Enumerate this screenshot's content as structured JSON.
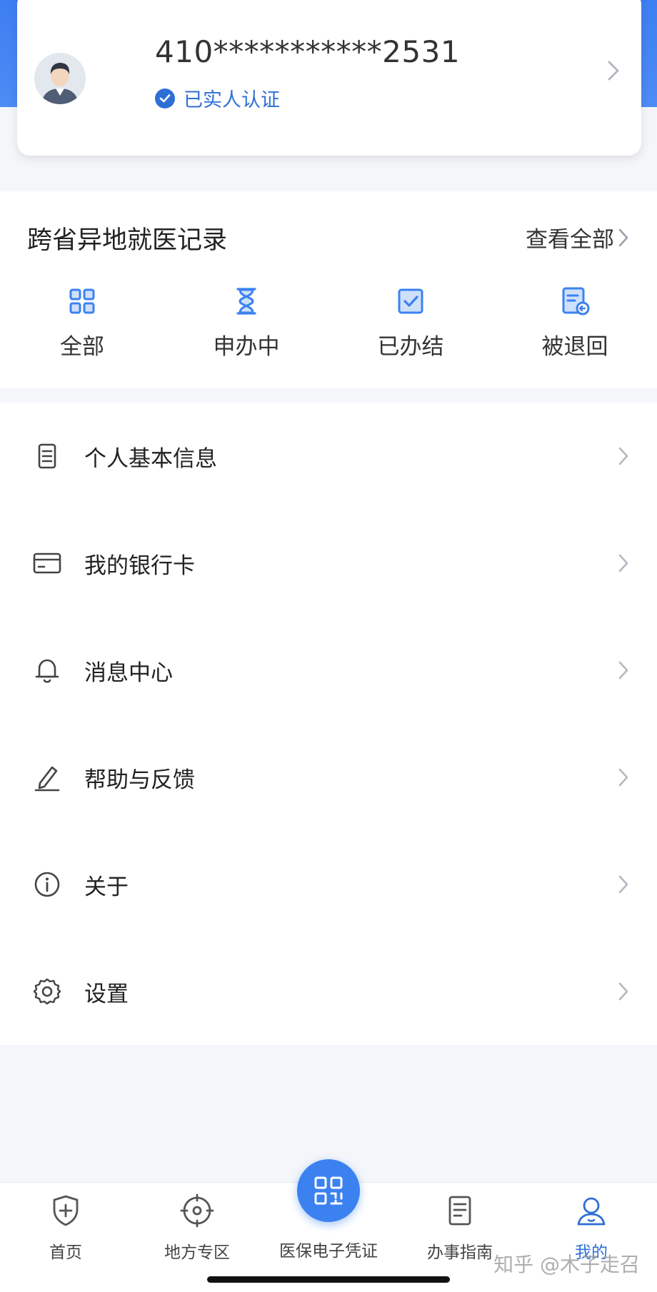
{
  "profile": {
    "id_masked": "410***********2531",
    "verified_label": "已实人认证"
  },
  "records": {
    "title": "跨省异地就医记录",
    "view_all": "查看全部",
    "tabs": [
      {
        "label": "全部",
        "icon": "grid-icon"
      },
      {
        "label": "申办中",
        "icon": "hourglass-icon"
      },
      {
        "label": "已办结",
        "icon": "checked-box-icon"
      },
      {
        "label": "被退回",
        "icon": "returned-document-icon"
      }
    ]
  },
  "menu": {
    "items": [
      {
        "label": "个人基本信息",
        "icon": "document-icon"
      },
      {
        "label": "我的银行卡",
        "icon": "card-icon"
      },
      {
        "label": "消息中心",
        "icon": "bell-icon"
      },
      {
        "label": "帮助与反馈",
        "icon": "pen-icon"
      },
      {
        "label": "关于",
        "icon": "info-icon"
      },
      {
        "label": "设置",
        "icon": "gear-icon"
      }
    ]
  },
  "nav": {
    "items": [
      {
        "label": "首页",
        "icon": "shield-plus-icon"
      },
      {
        "label": "地方专区",
        "icon": "target-icon"
      },
      {
        "label": "医保电子凭证",
        "icon": "qr-code-icon"
      },
      {
        "label": "办事指南",
        "icon": "guide-document-icon"
      },
      {
        "label": "我的",
        "icon": "user-icon",
        "active": true
      }
    ]
  },
  "watermark": "知乎 @木子走召",
  "colors": {
    "accent": "#2e6fd6",
    "header_blue": "#3d7ef2",
    "icon_blue": "#3b82f0"
  }
}
